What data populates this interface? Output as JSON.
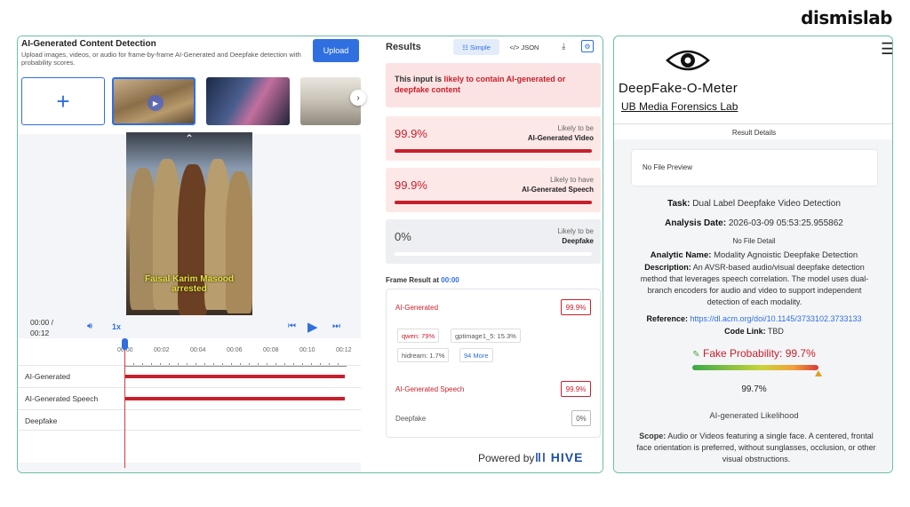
{
  "brand": "dismislab",
  "hive": {
    "detection": {
      "title": "AI-Generated Content Detection",
      "subtitle": "Upload images, videos, or audio for frame-by-frame AI-Generated and Deepfake detection with probability scores.",
      "upload_label": "Upload",
      "add_label": "+",
      "next_label": "›"
    },
    "video": {
      "caption": "Faisal Karim Masood arrested"
    },
    "player": {
      "time": "00:00 /",
      "duration": "00:12",
      "speed": "1x"
    },
    "timeline": {
      "ticks": [
        "00:00",
        "00:02",
        "00:04",
        "00:06",
        "00:08",
        "00:10",
        "00:12"
      ],
      "tracks": [
        {
          "label": "AI-Generated",
          "value": 1.0
        },
        {
          "label": "AI-Generated Speech",
          "value": 1.0
        },
        {
          "label": "Deepfake",
          "value": 0.0
        }
      ]
    },
    "results": {
      "title": "Results",
      "simple_label": "Simple",
      "json_label": "</> JSON",
      "alert_prefix": "This input is ",
      "alert_highlight": "likely to contain AI-generated or deepfake content",
      "cards": [
        {
          "value": "99.9%",
          "line1": "Likely to be",
          "line2": "AI-Generated Video",
          "fill": 0.999
        },
        {
          "value": "99.9%",
          "line1": "Likely to have",
          "line2": "AI-Generated Speech",
          "fill": 0.999
        },
        {
          "value": "0%",
          "line1": "Likely to be",
          "line2": "Deepfake",
          "fill": 0.0
        }
      ],
      "frame_prefix": "Frame Result at ",
      "frame_time": "00:00",
      "frame": {
        "ai_label": "AI-Generated",
        "ai_value": "99.9%",
        "chips": [
          "qwen: 79%",
          "gptimage1_5: 15.3%",
          "hidream: 1.7%",
          "94 More"
        ],
        "speech_label": "AI-Generated Speech",
        "speech_value": "99.9%",
        "deepfake_label": "Deepfake",
        "deepfake_value": "0%"
      },
      "powered_by": "Powered by",
      "hive_logo": "HIVE"
    }
  },
  "dfo": {
    "title": "DeepFake-O-Meter",
    "lab": "UB Media Forensics Lab",
    "details_label": "Result Details",
    "preview": "No File Preview",
    "task_label": "Task:",
    "task": "Dual Label Deepfake Video Detection",
    "date_label": "Analysis Date:",
    "date": "2026-03-09 05:53:25.955862",
    "no_detail": "No File Detail",
    "analytic_label": "Analytic Name:",
    "analytic": "Modality Agnoistic Deepfake Detection",
    "desc_label": "Description:",
    "desc": "An AVSR-based audio/visual deepfake detection method that leverages speech correlation. The model uses dual-branch encoders for audio and video to support independent detection of each modality.",
    "ref_label": "Reference:",
    "ref": "https://dl.acm.org/doi/10.1145/3733102.3733133",
    "code_label": "Code Link:",
    "code": "TBD",
    "fake_prob": "Fake Probability: 99.7%",
    "fake_prob_value": 0.997,
    "gauge_value": "99.7%",
    "likelihood": "AI-generated Likelihood",
    "scope_label": "Scope:",
    "scope": "Audio or Videos featuring a single face. A centered, frontal face orientation is preferred, without sunglasses, occlusion, or other visual obstructions."
  }
}
